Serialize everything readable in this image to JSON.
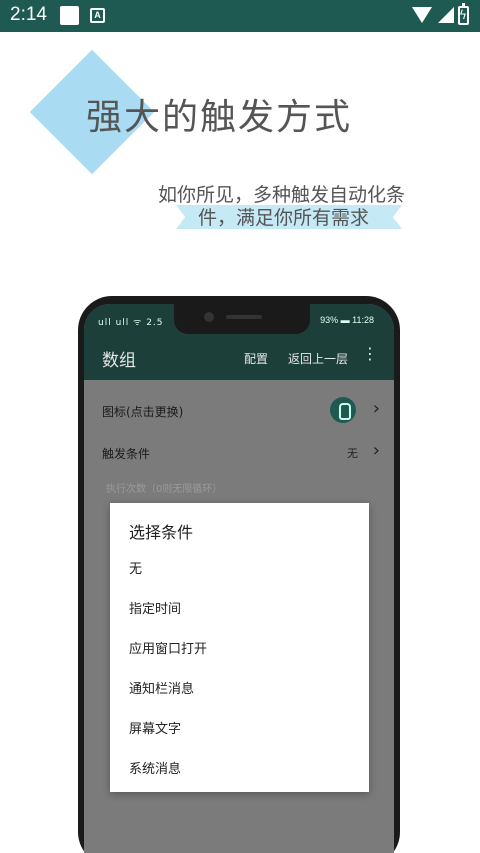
{
  "status_bar": {
    "time": "2:14",
    "icons": [
      "notification-square-icon",
      "a-badge-icon",
      "wifi-icon",
      "signal-icon",
      "battery-charging-icon"
    ]
  },
  "promo": {
    "title": "强大的触发方式",
    "subtitle_line1": "如你所见，多种触发自动化条",
    "subtitle_line2": "件，满足你所有需求"
  },
  "app": {
    "status": {
      "left": "ull ull ᯤ 2.5",
      "right": "93% ▬ 11:28"
    },
    "appbar": {
      "title": "数组",
      "action1": "配置",
      "action2": "返回上一层",
      "more_icon": "⋮"
    },
    "rows": [
      {
        "label": "图标(点击更换)",
        "value": "",
        "icon": "touch-finger-icon"
      },
      {
        "label": "触发条件",
        "value": "无",
        "icon": ""
      }
    ],
    "hint": "执行次数（0则无限循环）"
  },
  "dialog": {
    "title": "选择条件",
    "options": [
      "无",
      "指定时间",
      "应用窗口打开",
      "通知栏消息",
      "屏幕文字",
      "系统消息"
    ]
  },
  "colors": {
    "status_bar": "#1e5a52",
    "app_bar": "#1c3f3a",
    "diamond": "#a9dcf3",
    "ribbon": "#c6e9f6"
  }
}
